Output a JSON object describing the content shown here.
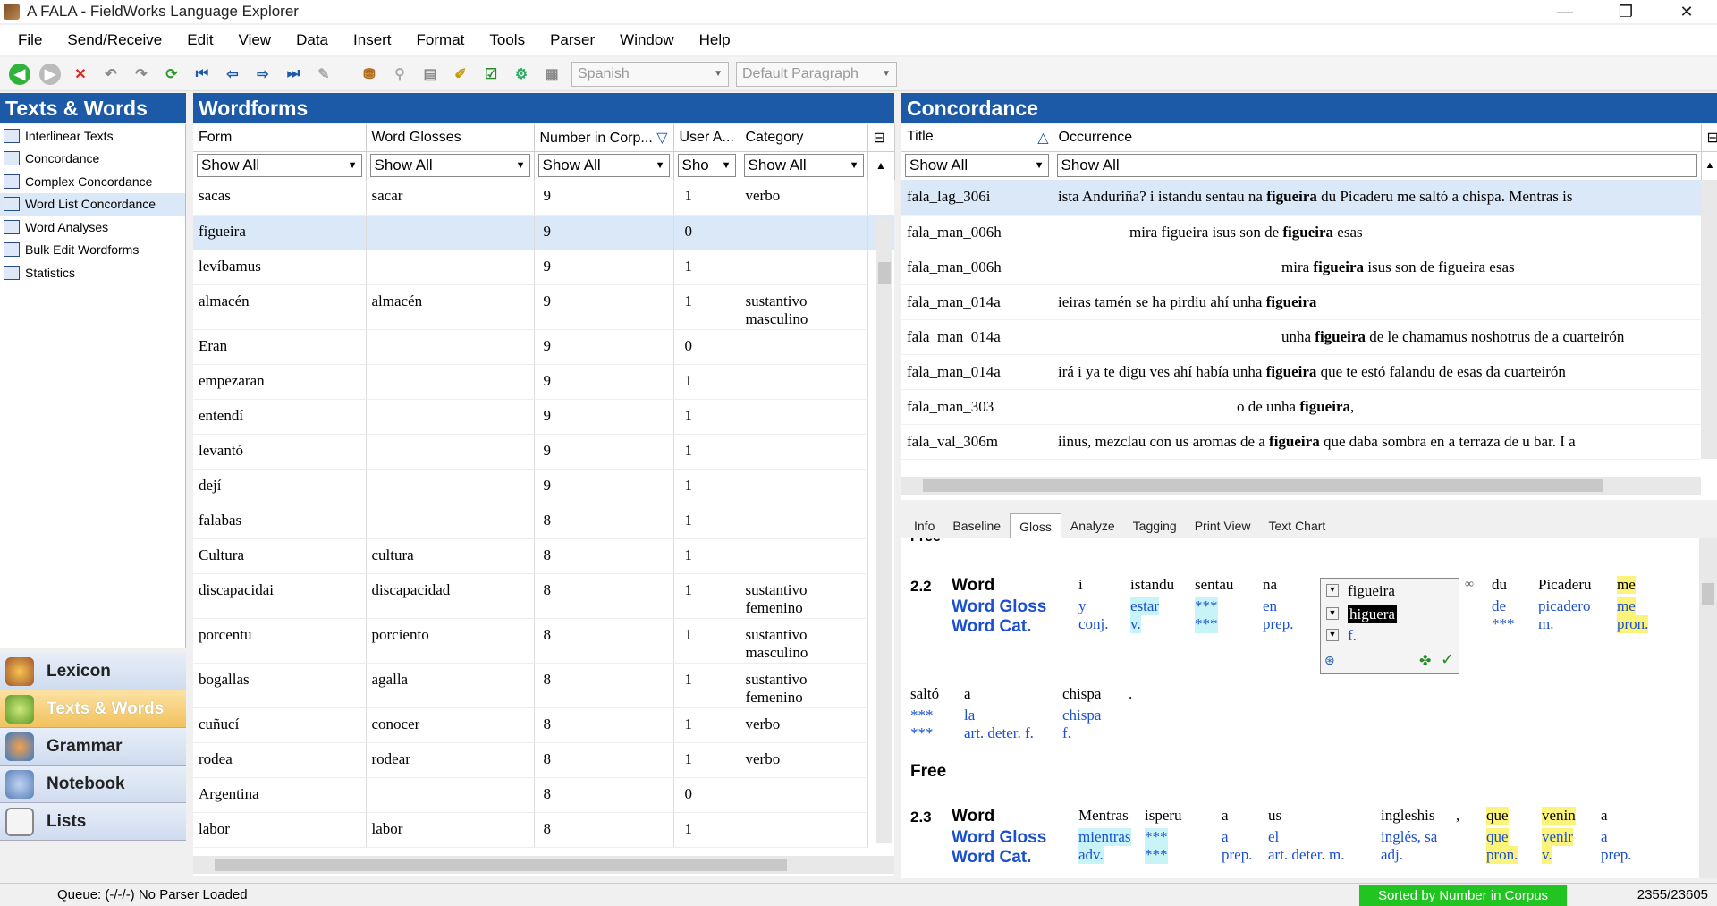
{
  "window": {
    "title": "A FALA - FieldWorks Language Explorer",
    "controls": [
      "—",
      "❐",
      "✕"
    ]
  },
  "menu": [
    "File",
    "Send/Receive",
    "Edit",
    "View",
    "Data",
    "Insert",
    "Format",
    "Tools",
    "Parser",
    "Window",
    "Help"
  ],
  "toolbar": {
    "writing_system": "Spanish",
    "style": "Default Paragraph"
  },
  "left_nav": {
    "header": "Texts & Words",
    "items": [
      "Interlinear Texts",
      "Concordance",
      "Complex Concordance",
      "Word List Concordance",
      "Word Analyses",
      "Bulk Edit Wordforms",
      "Statistics"
    ],
    "areas": [
      "Lexicon",
      "Texts & Words",
      "Grammar",
      "Notebook",
      "Lists"
    ]
  },
  "wordforms": {
    "header": "Wordforms",
    "columns": [
      "Form",
      "Word Glosses",
      "Number in Corp...",
      "User A...",
      "Category"
    ],
    "filters": [
      "Show All",
      "Show All",
      "Show All",
      "Sho",
      "Show All"
    ],
    "rows": [
      {
        "form": "sacas",
        "gloss": "sacar",
        "num": "9",
        "user": "1",
        "cat": "verbo"
      },
      {
        "form": "figueira",
        "gloss": "",
        "num": "9",
        "user": "0",
        "cat": ""
      },
      {
        "form": "levíbamus",
        "gloss": "",
        "num": "9",
        "user": "1",
        "cat": ""
      },
      {
        "form": "almacén",
        "gloss": "almacén",
        "num": "9",
        "user": "1",
        "cat": "sustantivo masculino"
      },
      {
        "form": "Eran",
        "gloss": "",
        "num": "9",
        "user": "0",
        "cat": ""
      },
      {
        "form": "empezaran",
        "gloss": "",
        "num": "9",
        "user": "1",
        "cat": ""
      },
      {
        "form": "entendí",
        "gloss": "",
        "num": "9",
        "user": "1",
        "cat": ""
      },
      {
        "form": "levantó",
        "gloss": "",
        "num": "9",
        "user": "1",
        "cat": ""
      },
      {
        "form": "dejí",
        "gloss": "",
        "num": "9",
        "user": "1",
        "cat": ""
      },
      {
        "form": "falabas",
        "gloss": "",
        "num": "8",
        "user": "1",
        "cat": ""
      },
      {
        "form": "Cultura",
        "gloss": "cultura",
        "num": "8",
        "user": "1",
        "cat": ""
      },
      {
        "form": "discapacidai",
        "gloss": "discapacidad",
        "num": "8",
        "user": "1",
        "cat": "sustantivo femenino"
      },
      {
        "form": "porcentu",
        "gloss": "porciento",
        "num": "8",
        "user": "1",
        "cat": "sustantivo masculino"
      },
      {
        "form": "bogallas",
        "gloss": "agalla",
        "num": "8",
        "user": "1",
        "cat": "sustantivo femenino"
      },
      {
        "form": "cuñucí",
        "gloss": "conocer",
        "num": "8",
        "user": "1",
        "cat": "verbo"
      },
      {
        "form": "rodea",
        "gloss": "rodear",
        "num": "8",
        "user": "1",
        "cat": "verbo"
      },
      {
        "form": "Argentina",
        "gloss": "",
        "num": "8",
        "user": "0",
        "cat": ""
      },
      {
        "form": "labor",
        "gloss": "labor",
        "num": "8",
        "user": "1",
        "cat": ""
      }
    ]
  },
  "concordance": {
    "header": "Concordance",
    "columns": [
      "Title",
      "Occurrence"
    ],
    "filters": [
      "Show All",
      "Show All"
    ],
    "rows": [
      {
        "title": "fala_lag_306i",
        "pre": "ista Anduriña? i istandu sentau na ",
        "kw": "figueira",
        "post": " du Picaderu me saltó a chispa. Mentras is"
      },
      {
        "title": "fala_man_006h",
        "pre": "mira figueira isus son de ",
        "kw": "figueira",
        "post": " esas"
      },
      {
        "title": "fala_man_006h",
        "pre": "mira ",
        "kw": "figueira",
        "post": " isus son de figueira esas"
      },
      {
        "title": "fala_man_014a",
        "pre": "ieiras tamén se ha pirdiu ahí unha ",
        "kw": "figueira",
        "post": ""
      },
      {
        "title": "fala_man_014a",
        "pre": "unha ",
        "kw": "figueira",
        "post": " de le chamamus noshotrus de a cuarteirón"
      },
      {
        "title": "fala_man_014a",
        "pre": "irá i ya te digu ves ahí había unha ",
        "kw": "figueira",
        "post": " que te estó falandu de esas da cuarteirón"
      },
      {
        "title": "fala_man_303",
        "pre": "o de unha ",
        "kw": "figueira",
        "post": ","
      },
      {
        "title": "fala_val_306m",
        "pre": "iinus, mezclau con us aromas de a ",
        "kw": "figueira",
        "post": " que daba sombra en a terraza de u bar. I a"
      }
    ]
  },
  "detail_tabs": [
    "Info",
    "Baseline",
    "Gloss",
    "Analyze",
    "Tagging",
    "Print View",
    "Text Chart"
  ],
  "interlinear": {
    "top_cut": "Free",
    "seg1": {
      "num": "2.2",
      "labels": [
        "Word",
        "Word Gloss",
        "Word Cat."
      ],
      "words": [
        {
          "w": "i",
          "g": "y",
          "c": "conj."
        },
        {
          "w": "istandu",
          "g": "estar",
          "c": "v."
        },
        {
          "w": "sentau",
          "g": "***",
          "c": "***"
        },
        {
          "w": "na",
          "g": "en",
          "c": "prep."
        },
        {
          "w": "du",
          "g": "de",
          "c": "***"
        },
        {
          "w": "Picaderu",
          "g": "picadero",
          "c": "m."
        },
        {
          "w": "me",
          "g": "me",
          "c": "pron."
        }
      ],
      "sandbox": {
        "word": "figueira",
        "gloss": "higuera",
        "cat": "f."
      },
      "line2": [
        {
          "w": "saltó",
          "g": "***",
          "c": "***"
        },
        {
          "w": "a",
          "g": "la",
          "c": "art. deter. f."
        },
        {
          "w": "chispa",
          "g": "chispa",
          "c": "f."
        },
        {
          "w": ".",
          "g": "",
          "c": ""
        }
      ]
    },
    "free": "Free",
    "seg2": {
      "num": "2.3",
      "labels": [
        "Word",
        "Word Gloss",
        "Word Cat."
      ],
      "words": [
        {
          "w": "Mentras",
          "g": "mientras",
          "c": "adv."
        },
        {
          "w": "isperu",
          "g": "***",
          "c": "***"
        },
        {
          "w": "a",
          "g": "a",
          "c": "prep."
        },
        {
          "w": "us",
          "g": "el",
          "c": "art. deter. m."
        },
        {
          "w": "ingleshis",
          "g": "inglés, sa",
          "c": "adj."
        },
        {
          "w": ",",
          "g": "",
          "c": ""
        },
        {
          "w": "que",
          "g": "que",
          "c": "pron."
        },
        {
          "w": "venin",
          "g": "venir",
          "c": "v."
        },
        {
          "w": "a",
          "g": "a",
          "c": "prep."
        }
      ]
    }
  },
  "status": {
    "queue": "Queue: (-/-/-) No Parser Loaded",
    "sort": "Sorted by Number in Corpus",
    "count": "2355/23605"
  },
  "colors": {
    "header_blue": "#1c5aa8",
    "selection": "#dbe8f8",
    "status_green": "#22c422"
  }
}
